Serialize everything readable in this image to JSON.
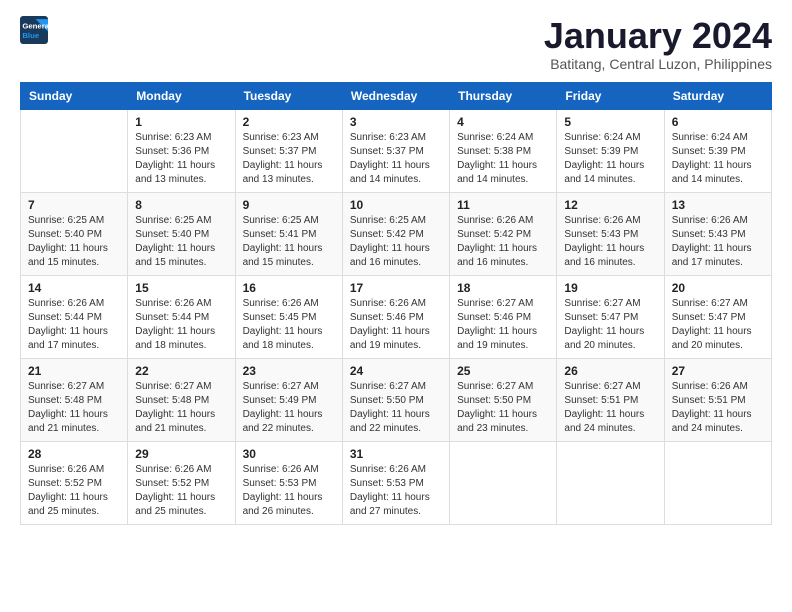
{
  "logo": {
    "line1": "General",
    "line2": "Blue"
  },
  "title": "January 2024",
  "subtitle": "Batitang, Central Luzon, Philippines",
  "days_of_week": [
    "Sunday",
    "Monday",
    "Tuesday",
    "Wednesday",
    "Thursday",
    "Friday",
    "Saturday"
  ],
  "weeks": [
    [
      {
        "day": "",
        "sunrise": "",
        "sunset": "",
        "daylight": ""
      },
      {
        "day": "1",
        "sunrise": "6:23 AM",
        "sunset": "5:36 PM",
        "daylight": "11 hours and 13 minutes."
      },
      {
        "day": "2",
        "sunrise": "6:23 AM",
        "sunset": "5:37 PM",
        "daylight": "11 hours and 13 minutes."
      },
      {
        "day": "3",
        "sunrise": "6:23 AM",
        "sunset": "5:37 PM",
        "daylight": "11 hours and 14 minutes."
      },
      {
        "day": "4",
        "sunrise": "6:24 AM",
        "sunset": "5:38 PM",
        "daylight": "11 hours and 14 minutes."
      },
      {
        "day": "5",
        "sunrise": "6:24 AM",
        "sunset": "5:39 PM",
        "daylight": "11 hours and 14 minutes."
      },
      {
        "day": "6",
        "sunrise": "6:24 AM",
        "sunset": "5:39 PM",
        "daylight": "11 hours and 14 minutes."
      }
    ],
    [
      {
        "day": "7",
        "sunrise": "6:25 AM",
        "sunset": "5:40 PM",
        "daylight": "11 hours and 15 minutes."
      },
      {
        "day": "8",
        "sunrise": "6:25 AM",
        "sunset": "5:40 PM",
        "daylight": "11 hours and 15 minutes."
      },
      {
        "day": "9",
        "sunrise": "6:25 AM",
        "sunset": "5:41 PM",
        "daylight": "11 hours and 15 minutes."
      },
      {
        "day": "10",
        "sunrise": "6:25 AM",
        "sunset": "5:42 PM",
        "daylight": "11 hours and 16 minutes."
      },
      {
        "day": "11",
        "sunrise": "6:26 AM",
        "sunset": "5:42 PM",
        "daylight": "11 hours and 16 minutes."
      },
      {
        "day": "12",
        "sunrise": "6:26 AM",
        "sunset": "5:43 PM",
        "daylight": "11 hours and 16 minutes."
      },
      {
        "day": "13",
        "sunrise": "6:26 AM",
        "sunset": "5:43 PM",
        "daylight": "11 hours and 17 minutes."
      }
    ],
    [
      {
        "day": "14",
        "sunrise": "6:26 AM",
        "sunset": "5:44 PM",
        "daylight": "11 hours and 17 minutes."
      },
      {
        "day": "15",
        "sunrise": "6:26 AM",
        "sunset": "5:44 PM",
        "daylight": "11 hours and 18 minutes."
      },
      {
        "day": "16",
        "sunrise": "6:26 AM",
        "sunset": "5:45 PM",
        "daylight": "11 hours and 18 minutes."
      },
      {
        "day": "17",
        "sunrise": "6:26 AM",
        "sunset": "5:46 PM",
        "daylight": "11 hours and 19 minutes."
      },
      {
        "day": "18",
        "sunrise": "6:27 AM",
        "sunset": "5:46 PM",
        "daylight": "11 hours and 19 minutes."
      },
      {
        "day": "19",
        "sunrise": "6:27 AM",
        "sunset": "5:47 PM",
        "daylight": "11 hours and 20 minutes."
      },
      {
        "day": "20",
        "sunrise": "6:27 AM",
        "sunset": "5:47 PM",
        "daylight": "11 hours and 20 minutes."
      }
    ],
    [
      {
        "day": "21",
        "sunrise": "6:27 AM",
        "sunset": "5:48 PM",
        "daylight": "11 hours and 21 minutes."
      },
      {
        "day": "22",
        "sunrise": "6:27 AM",
        "sunset": "5:48 PM",
        "daylight": "11 hours and 21 minutes."
      },
      {
        "day": "23",
        "sunrise": "6:27 AM",
        "sunset": "5:49 PM",
        "daylight": "11 hours and 22 minutes."
      },
      {
        "day": "24",
        "sunrise": "6:27 AM",
        "sunset": "5:50 PM",
        "daylight": "11 hours and 22 minutes."
      },
      {
        "day": "25",
        "sunrise": "6:27 AM",
        "sunset": "5:50 PM",
        "daylight": "11 hours and 23 minutes."
      },
      {
        "day": "26",
        "sunrise": "6:27 AM",
        "sunset": "5:51 PM",
        "daylight": "11 hours and 24 minutes."
      },
      {
        "day": "27",
        "sunrise": "6:26 AM",
        "sunset": "5:51 PM",
        "daylight": "11 hours and 24 minutes."
      }
    ],
    [
      {
        "day": "28",
        "sunrise": "6:26 AM",
        "sunset": "5:52 PM",
        "daylight": "11 hours and 25 minutes."
      },
      {
        "day": "29",
        "sunrise": "6:26 AM",
        "sunset": "5:52 PM",
        "daylight": "11 hours and 25 minutes."
      },
      {
        "day": "30",
        "sunrise": "6:26 AM",
        "sunset": "5:53 PM",
        "daylight": "11 hours and 26 minutes."
      },
      {
        "day": "31",
        "sunrise": "6:26 AM",
        "sunset": "5:53 PM",
        "daylight": "11 hours and 27 minutes."
      },
      {
        "day": "",
        "sunrise": "",
        "sunset": "",
        "daylight": ""
      },
      {
        "day": "",
        "sunrise": "",
        "sunset": "",
        "daylight": ""
      },
      {
        "day": "",
        "sunrise": "",
        "sunset": "",
        "daylight": ""
      }
    ]
  ]
}
